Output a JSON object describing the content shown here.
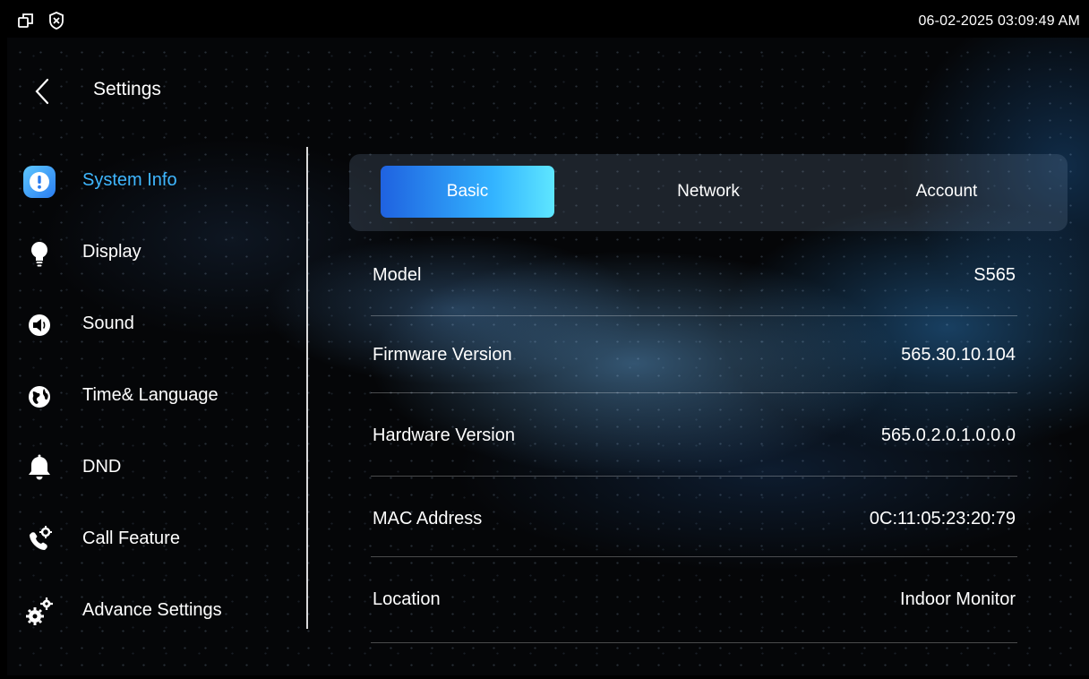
{
  "status_bar": {
    "datetime": "06-02-2025 03:09:49 AM",
    "icons": [
      "window-icon",
      "shield-x-icon"
    ]
  },
  "header": {
    "title": "Settings",
    "back_icon": "chevron-left-icon"
  },
  "sidebar": {
    "items": [
      {
        "label": "System Info",
        "icon": "info-icon",
        "active": true
      },
      {
        "label": "Display",
        "icon": "lightbulb-icon",
        "active": false
      },
      {
        "label": "Sound",
        "icon": "speaker-icon",
        "active": false
      },
      {
        "label": "Time& Language",
        "icon": "globe-icon",
        "active": false
      },
      {
        "label": "DND",
        "icon": "bell-icon",
        "active": false
      },
      {
        "label": "Call Feature",
        "icon": "phone-gear-icon",
        "active": false
      },
      {
        "label": "Advance Settings",
        "icon": "gears-icon",
        "active": false
      }
    ]
  },
  "tabs": [
    {
      "label": "Basic",
      "active": true
    },
    {
      "label": "Network",
      "active": false
    },
    {
      "label": "Account",
      "active": false
    }
  ],
  "basic_info": [
    {
      "label": "Model",
      "value": "S565"
    },
    {
      "label": "Firmware Version",
      "value": "565.30.10.104"
    },
    {
      "label": "Hardware Version",
      "value": "565.0.2.0.1.0.0.0"
    },
    {
      "label": "MAC Address",
      "value": "0C:11:05:23:20:79"
    },
    {
      "label": "Location",
      "value": "Indoor Monitor"
    }
  ],
  "colors": {
    "accent": "#3fb7ff",
    "tab_active_start": "#1f62e0",
    "tab_active_end": "#5ee6ff"
  }
}
